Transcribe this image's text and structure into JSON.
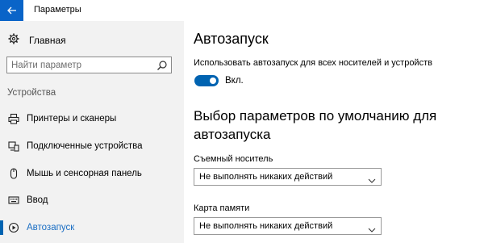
{
  "window": {
    "title": "Параметры",
    "back_icon": "back-arrow-icon",
    "accent": "#0a64c8"
  },
  "sidebar": {
    "home": {
      "label": "Главная",
      "icon": "gear-icon"
    },
    "search": {
      "placeholder": "Найти параметр",
      "icon": "search-icon"
    },
    "section": "Устройства",
    "items": [
      {
        "label": "Принтеры и сканеры",
        "icon": "printer-icon",
        "active": false
      },
      {
        "label": "Подключенные устройства",
        "icon": "connected-devices-icon",
        "active": false
      },
      {
        "label": "Мышь и сенсорная панель",
        "icon": "mouse-icon",
        "active": false
      },
      {
        "label": "Ввод",
        "icon": "keyboard-icon",
        "active": false
      },
      {
        "label": "Автозапуск",
        "icon": "autoplay-icon",
        "active": true
      }
    ]
  },
  "main": {
    "title": "Автозапуск",
    "autoplay_toggle": {
      "label": "Использовать автозапуск для всех носителей и устройств",
      "state": "Вкл.",
      "on": true
    },
    "defaults_heading": "Выбор параметров по умолчанию для автозапуска",
    "fields": [
      {
        "label": "Съемный носитель",
        "value": "Не выполнять никаких действий"
      },
      {
        "label": "Карта памяти",
        "value": "Не выполнять никаких действий"
      }
    ]
  }
}
